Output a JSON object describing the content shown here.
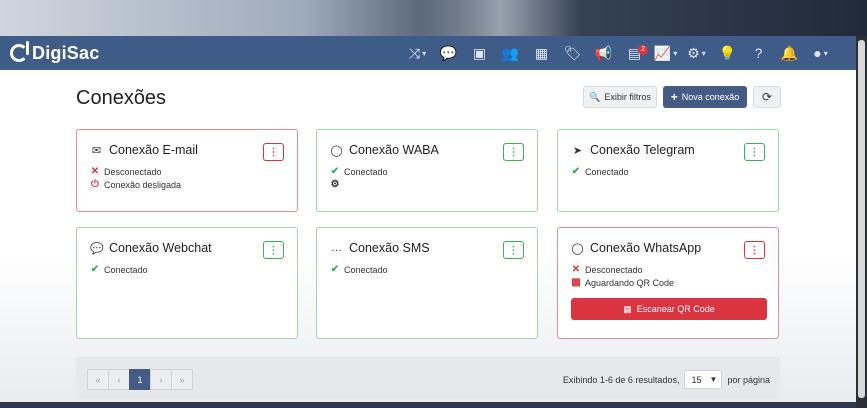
{
  "brand": {
    "name": "DigiSac"
  },
  "navbar": {
    "icons": [
      {
        "name": "shuffle-icon",
        "glyph": "⤨",
        "caret": true
      },
      {
        "name": "chat-icon",
        "glyph": "💬",
        "caret": false
      },
      {
        "name": "contacts-icon",
        "glyph": "▣",
        "caret": false
      },
      {
        "name": "users-icon",
        "glyph": "👥",
        "caret": false
      },
      {
        "name": "building-icon",
        "glyph": "▦",
        "caret": false
      },
      {
        "name": "tags-icon",
        "glyph": "🏷",
        "caret": false
      },
      {
        "name": "megaphone-icon",
        "glyph": "📢",
        "caret": false
      },
      {
        "name": "notifications-icon",
        "glyph": "▤",
        "caret": false,
        "badge": "2"
      },
      {
        "name": "chart-icon",
        "glyph": "📈",
        "caret": true
      },
      {
        "name": "gear-icon",
        "glyph": "⚙",
        "caret": true
      },
      {
        "name": "lightbulb-icon",
        "glyph": "💡",
        "caret": false
      },
      {
        "name": "help-icon",
        "glyph": "?",
        "caret": false
      },
      {
        "name": "bell-icon",
        "glyph": "🔔",
        "caret": false
      },
      {
        "name": "user-avatar-icon",
        "glyph": "●",
        "caret": true
      }
    ]
  },
  "page": {
    "title": "Conexões",
    "filter_label": "Exibir filtros",
    "new_label": "Nova conexão"
  },
  "cards": [
    {
      "title": "Conexão E-mail",
      "icon": "✉",
      "icon_name": "email-icon",
      "color": "red",
      "statuses": [
        {
          "icon": "✕",
          "icon_name": "x-icon",
          "tone": "red",
          "text": "Desconectado"
        },
        {
          "icon": "⏻",
          "icon_name": "power-icon",
          "tone": "red",
          "text": "Conexão desligada"
        }
      ]
    },
    {
      "title": "Conexão WABA",
      "icon": "◯",
      "icon_name": "whatsapp-icon",
      "color": "green",
      "statuses": [
        {
          "icon": "✔",
          "icon_name": "check-icon",
          "tone": "green",
          "text": "Conectado"
        },
        {
          "icon": "⚙",
          "icon_name": "cogs-icon",
          "tone": "dark",
          "text": ""
        }
      ]
    },
    {
      "title": "Conexão Telegram",
      "icon": "➤",
      "icon_name": "telegram-icon",
      "color": "green",
      "statuses": [
        {
          "icon": "✔",
          "icon_name": "check-icon",
          "tone": "green",
          "text": "Conectado"
        }
      ]
    },
    {
      "title": "Conexão Webchat",
      "icon": "💬",
      "icon_name": "comments-icon",
      "color": "green",
      "statuses": [
        {
          "icon": "✔",
          "icon_name": "check-icon",
          "tone": "green",
          "text": "Conectado"
        }
      ]
    },
    {
      "title": "Conexão SMS",
      "icon": "…",
      "icon_name": "sms-icon",
      "color": "green",
      "statuses": [
        {
          "icon": "✔",
          "icon_name": "check-icon",
          "tone": "green",
          "text": "Conectado"
        }
      ]
    },
    {
      "title": "Conexão WhatsApp",
      "icon": "◯",
      "icon_name": "whatsapp-icon",
      "color": "red",
      "statuses": [
        {
          "icon": "✕",
          "icon_name": "x-icon",
          "tone": "red",
          "text": "Desconectado"
        },
        {
          "icon": "▦",
          "icon_name": "qrcode-icon",
          "tone": "red",
          "text": "Aguardando QR Code"
        }
      ],
      "action": "Escanear QR Code"
    }
  ],
  "pagination": {
    "pages": [
      "«",
      "‹",
      "1",
      "›",
      "»"
    ],
    "active": "1",
    "summary": "Exibindo 1-6 de 6 resultados,",
    "per_page": "15",
    "per_page_label": "por página"
  },
  "colors": {
    "navbar": "#3f5b88",
    "primary": "#445b83",
    "danger": "#d9343f",
    "success": "#3fae5a"
  }
}
